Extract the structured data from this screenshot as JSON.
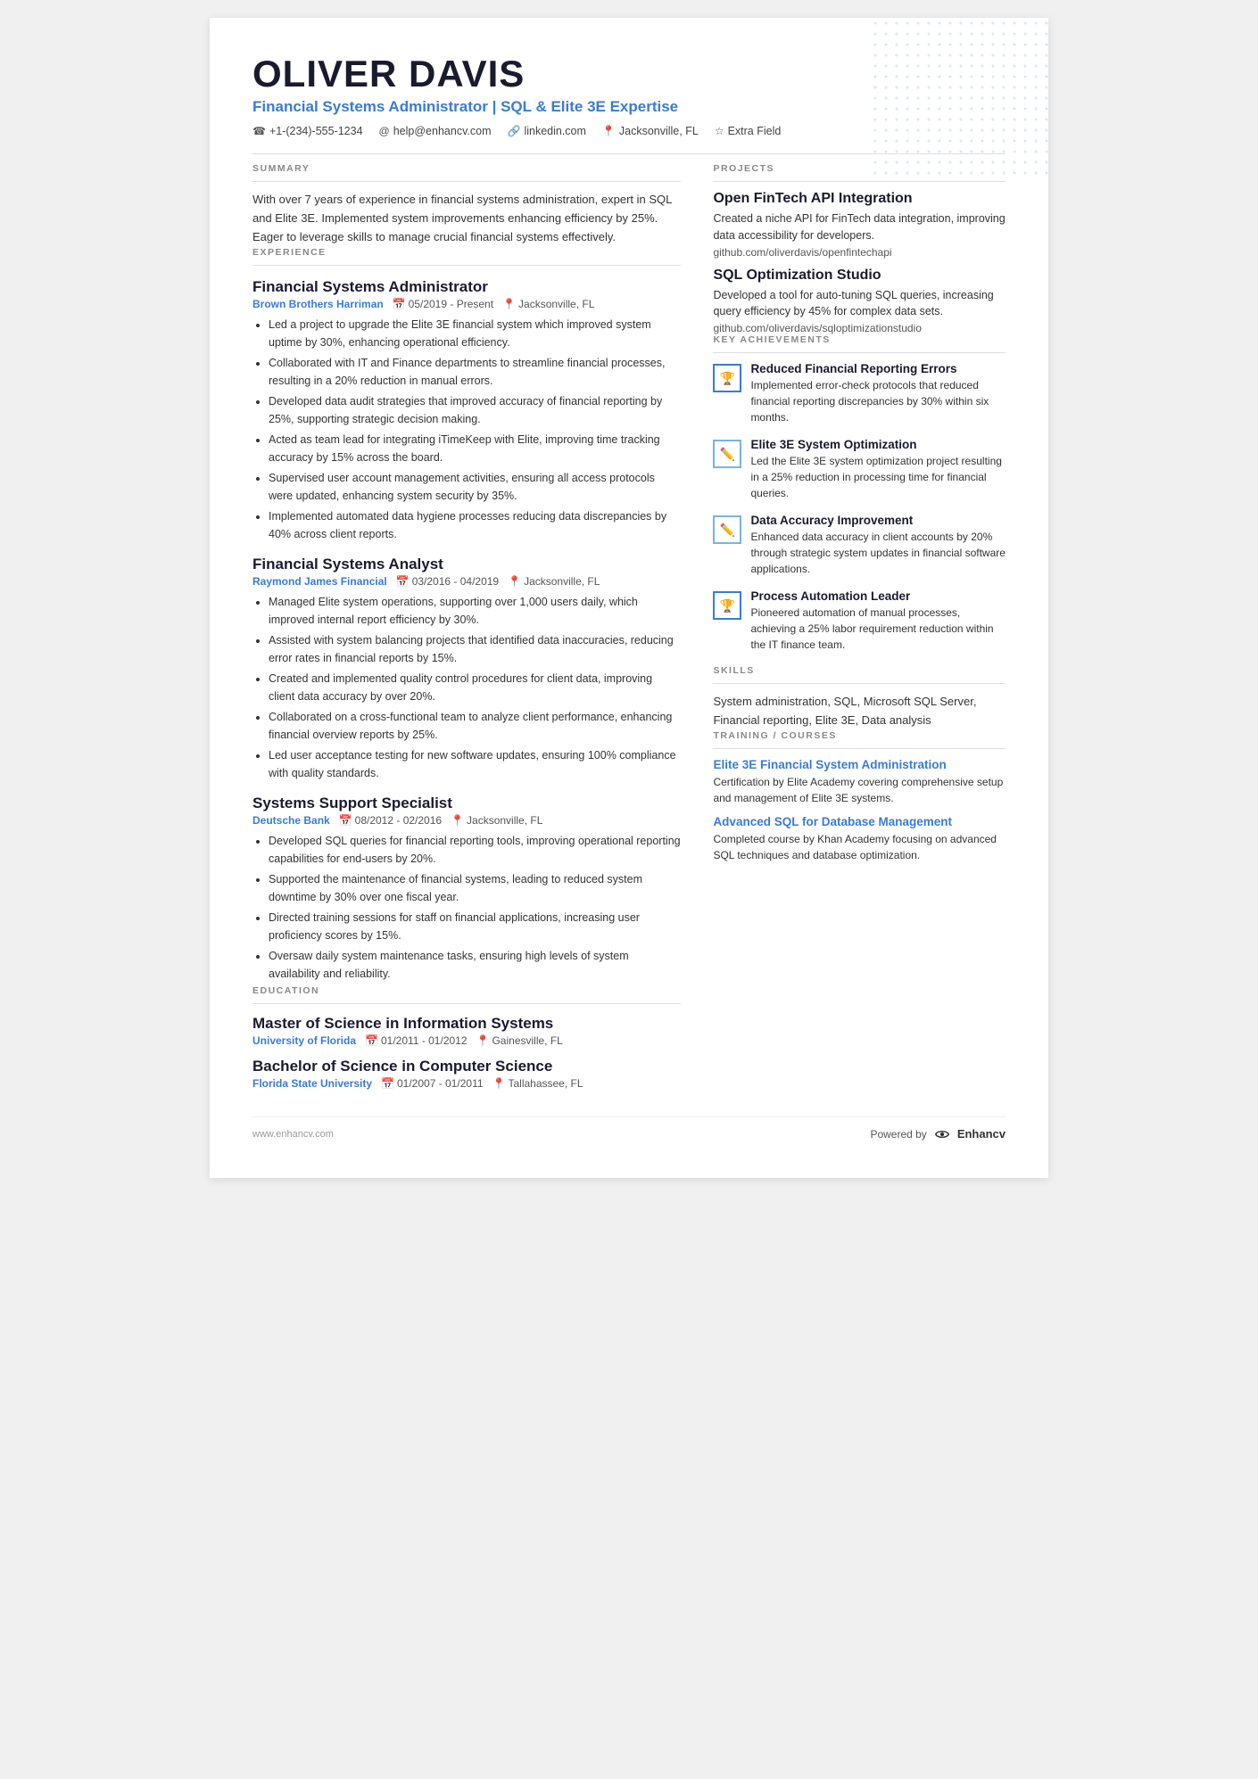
{
  "header": {
    "name": "OLIVER DAVIS",
    "title": "Financial Systems Administrator | SQL & Elite 3E Expertise",
    "phone": "+1-(234)-555-1234",
    "email": "help@enhancv.com",
    "linkedin": "linkedin.com",
    "location": "Jacksonville, FL",
    "extra": "Extra Field"
  },
  "summary": {
    "section_label": "SUMMARY",
    "text": "With over 7 years of experience in financial systems administration, expert in SQL and Elite 3E. Implemented system improvements enhancing efficiency by 25%. Eager to leverage skills to manage crucial financial systems effectively."
  },
  "experience": {
    "section_label": "EXPERIENCE",
    "jobs": [
      {
        "title": "Financial Systems Administrator",
        "company": "Brown Brothers Harriman",
        "dates": "05/2019 - Present",
        "location": "Jacksonville, FL",
        "bullets": [
          "Led a project to upgrade the Elite 3E financial system which improved system uptime by 30%, enhancing operational efficiency.",
          "Collaborated with IT and Finance departments to streamline financial processes, resulting in a 20% reduction in manual errors.",
          "Developed data audit strategies that improved accuracy of financial reporting by 25%, supporting strategic decision making.",
          "Acted as team lead for integrating iTimeKeep with Elite, improving time tracking accuracy by 15% across the board.",
          "Supervised user account management activities, ensuring all access protocols were updated, enhancing system security by 35%.",
          "Implemented automated data hygiene processes reducing data discrepancies by 40% across client reports."
        ]
      },
      {
        "title": "Financial Systems Analyst",
        "company": "Raymond James Financial",
        "dates": "03/2016 - 04/2019",
        "location": "Jacksonville, FL",
        "bullets": [
          "Managed Elite system operations, supporting over 1,000 users daily, which improved internal report efficiency by 30%.",
          "Assisted with system balancing projects that identified data inaccuracies, reducing error rates in financial reports by 15%.",
          "Created and implemented quality control procedures for client data, improving client data accuracy by over 20%.",
          "Collaborated on a cross-functional team to analyze client performance, enhancing financial overview reports by 25%.",
          "Led user acceptance testing for new software updates, ensuring 100% compliance with quality standards."
        ]
      },
      {
        "title": "Systems Support Specialist",
        "company": "Deutsche Bank",
        "dates": "08/2012 - 02/2016",
        "location": "Jacksonville, FL",
        "bullets": [
          "Developed SQL queries for financial reporting tools, improving operational reporting capabilities for end-users by 20%.",
          "Supported the maintenance of financial systems, leading to reduced system downtime by 30% over one fiscal year.",
          "Directed training sessions for staff on financial applications, increasing user proficiency scores by 15%.",
          "Oversaw daily system maintenance tasks, ensuring high levels of system availability and reliability."
        ]
      }
    ]
  },
  "education": {
    "section_label": "EDUCATION",
    "degrees": [
      {
        "degree": "Master of Science in Information Systems",
        "school": "University of Florida",
        "dates": "01/2011 - 01/2012",
        "location": "Gainesville, FL"
      },
      {
        "degree": "Bachelor of Science in Computer Science",
        "school": "Florida State University",
        "dates": "01/2007 - 01/2011",
        "location": "Tallahassee, FL"
      }
    ]
  },
  "projects": {
    "section_label": "PROJECTS",
    "items": [
      {
        "title": "Open FinTech API Integration",
        "description": "Created a niche API for FinTech data integration, improving data accessibility for developers.",
        "link": "github.com/oliverdavis/openfintechapi"
      },
      {
        "title": "SQL Optimization Studio",
        "description": "Developed a tool for auto-tuning SQL queries, increasing query efficiency by 45% for complex data sets.",
        "link": "github.com/oliverdavis/sqloptimizationstudio"
      }
    ]
  },
  "key_achievements": {
    "section_label": "KEY ACHIEVEMENTS",
    "items": [
      {
        "icon_type": "trophy",
        "title": "Reduced Financial Reporting Errors",
        "description": "Implemented error-check protocols that reduced financial reporting discrepancies by 30% within six months."
      },
      {
        "icon_type": "pencil",
        "title": "Elite 3E System Optimization",
        "description": "Led the Elite 3E system optimization project resulting in a 25% reduction in processing time for financial queries."
      },
      {
        "icon_type": "pencil",
        "title": "Data Accuracy Improvement",
        "description": "Enhanced data accuracy in client accounts by 20% through strategic system updates in financial software applications."
      },
      {
        "icon_type": "trophy",
        "title": "Process Automation Leader",
        "description": "Pioneered automation of manual processes, achieving a 25% labor requirement reduction within the IT finance team."
      }
    ]
  },
  "skills": {
    "section_label": "SKILLS",
    "text": "System administration, SQL, Microsoft SQL Server, Financial reporting, Elite 3E, Data analysis"
  },
  "training": {
    "section_label": "TRAINING / COURSES",
    "items": [
      {
        "title": "Elite 3E Financial System Administration",
        "description": "Certification by Elite Academy covering comprehensive setup and management of Elite 3E systems."
      },
      {
        "title": "Advanced SQL for Database Management",
        "description": "Completed course by Khan Academy focusing on advanced SQL techniques and database optimization."
      }
    ]
  },
  "footer": {
    "website": "www.enhancv.com",
    "powered_by": "Powered by",
    "brand": "Enhancv"
  }
}
